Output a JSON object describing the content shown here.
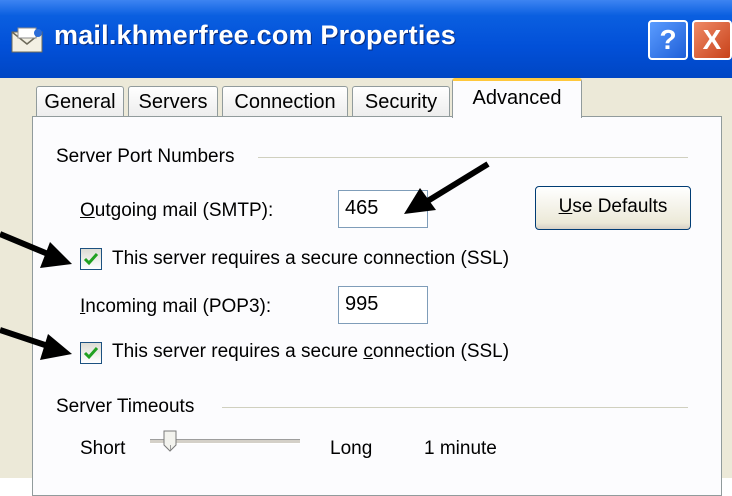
{
  "window": {
    "title": "mail.khmerfree.com Properties",
    "help_glyph": "?",
    "close_glyph": "X"
  },
  "tabs": [
    {
      "label": "General"
    },
    {
      "label": "Servers"
    },
    {
      "label": "Connection"
    },
    {
      "label": "Security"
    },
    {
      "label": "Advanced",
      "active": true
    }
  ],
  "ports": {
    "group_title": "Server Port Numbers",
    "outgoing": {
      "label_key": "O",
      "label_rest": "utgoing mail (SMTP):",
      "value": "465"
    },
    "use_defaults": {
      "key": "U",
      "rest": "se Defaults"
    },
    "ssl_outgoing": {
      "pre": "This server requires a secure connection (SSL)",
      "checked": true
    },
    "incoming": {
      "label_key": "I",
      "label_rest": "ncoming mail (POP3):",
      "value": "995"
    },
    "ssl_incoming": {
      "pre": "This server requires a secure ",
      "key": "c",
      "post": "onnection (SSL)",
      "checked": true
    }
  },
  "timeouts": {
    "group_title": "Server Timeouts",
    "short": "Short",
    "long": "Long",
    "value": "1 minute"
  },
  "colors": {
    "title_bar": "#0250d8",
    "dialog": "#ece9d8",
    "check": "#21a121",
    "active_tab_accent": "#ffc83c"
  },
  "icons": [
    "mail-envelope-icon",
    "help-icon",
    "close-icon",
    "checkbox-icon",
    "arrow-icon"
  ]
}
